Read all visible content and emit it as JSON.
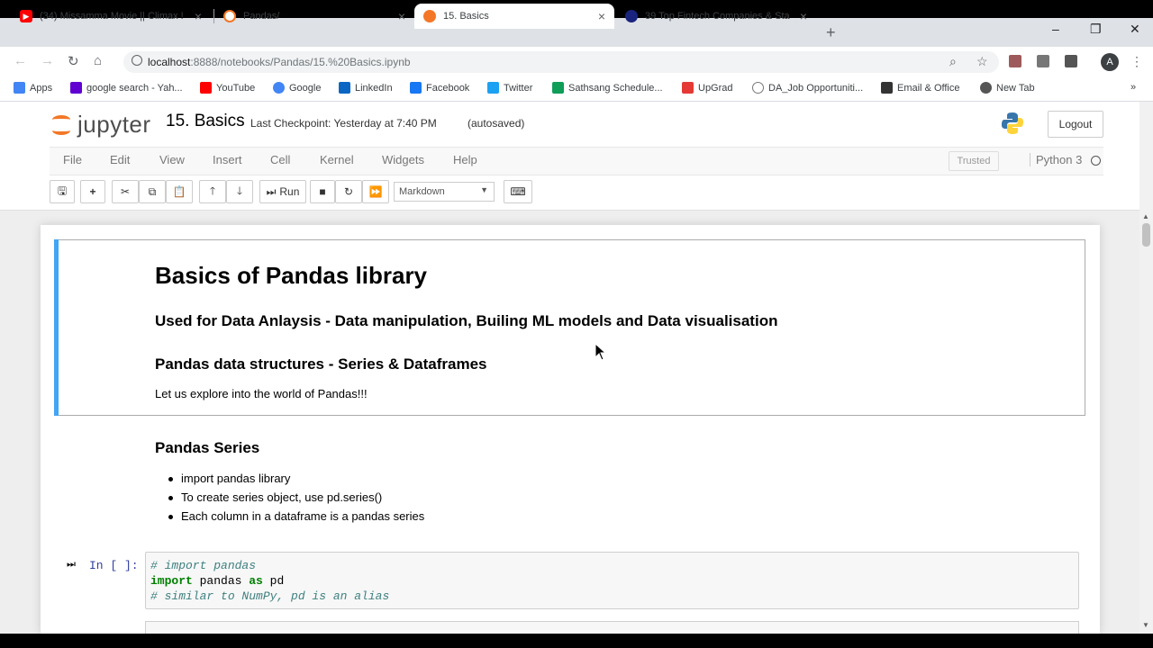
{
  "browser": {
    "tabs": [
      {
        "title": "(34) Missamma Movie || Climax !",
        "favicon_color": "#ff0000"
      },
      {
        "title": "Pandas/",
        "favicon_color": "#f37726"
      },
      {
        "title": "15. Basics",
        "favicon_color": "#f37726",
        "active": true
      },
      {
        "title": "39 Top Fintech Companies & Sta",
        "favicon_color": "#1a237e"
      }
    ],
    "url_host": "localhost",
    "url_path": ":8888/notebooks/Pandas/15.%20Basics.ipynb",
    "avatar_letter": "A",
    "bookmarks": [
      {
        "label": "Apps",
        "color": "#4285f4"
      },
      {
        "label": "google search - Yah...",
        "color": "#6001d2"
      },
      {
        "label": "YouTube",
        "color": "#ff0000"
      },
      {
        "label": "Google",
        "color": "#4285f4"
      },
      {
        "label": "LinkedIn",
        "color": "#0a66c2"
      },
      {
        "label": "Facebook",
        "color": "#1877f2"
      },
      {
        "label": "Twitter",
        "color": "#1da1f2"
      },
      {
        "label": "Sathsang Schedule...",
        "color": "#0f9d58"
      },
      {
        "label": "UpGrad",
        "color": "#e53935"
      },
      {
        "label": "DA_Job Opportuniti...",
        "color": "#777777"
      },
      {
        "label": "Email & Office",
        "color": "#333333"
      },
      {
        "label": "New Tab",
        "color": "#555555"
      }
    ]
  },
  "jupyter": {
    "logo_text": "jupyter",
    "notebook_name": "15. Basics",
    "checkpoint": "Last Checkpoint: Yesterday at 7:40 PM",
    "autosaved": "(autosaved)",
    "logout": "Logout",
    "menu": [
      "File",
      "Edit",
      "View",
      "Insert",
      "Cell",
      "Kernel",
      "Widgets",
      "Help"
    ],
    "trusted": "Trusted",
    "kernel": "Python 3",
    "run_label": "Run",
    "cell_type": "Markdown"
  },
  "cells": {
    "md1": {
      "h1": "Basics of Pandas library",
      "h3a": "Used for Data Anlaysis - Data manipulation, Builing ML models and Data visualisation",
      "h3b": "Pandas data structures - Series & Dataframes",
      "para": "Let us explore into the world of Pandas!!!"
    },
    "md2": {
      "h3": "Pandas Series",
      "bullets": [
        "import pandas library",
        "To create series object, use pd.series()",
        "Each column in a dataframe is a pandas series"
      ]
    },
    "code1": {
      "prompt": "In [ ]:",
      "line1": "# import pandas",
      "line2_kw": "import",
      "line2_mid": " pandas ",
      "line2_kw2": "as",
      "line2_end": " pd",
      "line3": "# similar to NumPy, pd is an alias"
    }
  }
}
